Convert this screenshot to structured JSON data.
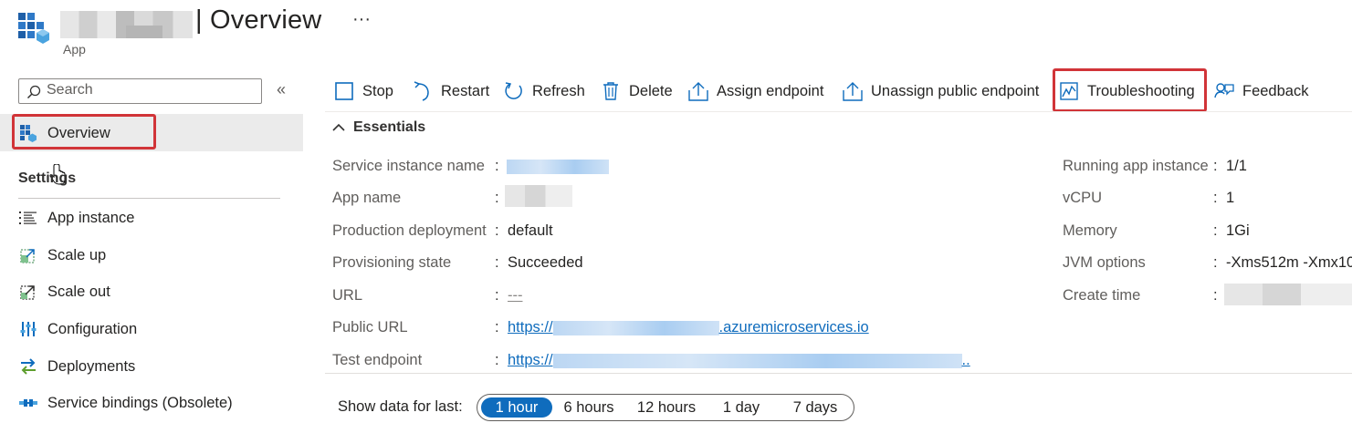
{
  "header": {
    "title": "| Overview",
    "more_label": "···",
    "resource_type": "App"
  },
  "sidebar": {
    "search_placeholder": "Search",
    "collapse_label": "«",
    "overview_label": "Overview",
    "settings_heading": "Settings",
    "items": [
      {
        "label": "App instance",
        "icon": "list-icon"
      },
      {
        "label": "Scale up",
        "icon": "scale-up-icon"
      },
      {
        "label": "Scale out",
        "icon": "scale-out-icon"
      },
      {
        "label": "Configuration",
        "icon": "configuration-icon"
      },
      {
        "label": "Deployments",
        "icon": "deployments-icon"
      },
      {
        "label": "Service bindings (Obsolete)",
        "icon": "service-bindings-icon"
      }
    ]
  },
  "toolbar": {
    "stop": "Stop",
    "restart": "Restart",
    "refresh": "Refresh",
    "delete": "Delete",
    "assign_endpoint": "Assign endpoint",
    "unassign_public_endpoint": "Unassign public endpoint",
    "troubleshooting": "Troubleshooting",
    "feedback": "Feedback"
  },
  "essentials": {
    "heading": "Essentials",
    "left": [
      {
        "key": "Service instance name",
        "value": ""
      },
      {
        "key": "App name",
        "value": ""
      },
      {
        "key": "Production deployment",
        "value": "default"
      },
      {
        "key": "Provisioning state",
        "value": "Succeeded"
      },
      {
        "key": "URL",
        "value": "---"
      },
      {
        "key": "Public URL",
        "value_prefix": "https://",
        "value_suffix": ".azuremicroservices.io"
      },
      {
        "key": "Test endpoint",
        "value_prefix": "https://",
        "value_suffix": ".."
      }
    ],
    "right": [
      {
        "key": "Running app instance",
        "value": "1/1"
      },
      {
        "key": "vCPU",
        "value": "1"
      },
      {
        "key": "Memory",
        "value": "1Gi"
      },
      {
        "key": "JVM options",
        "value": "-Xms512m -Xmx10"
      },
      {
        "key": "Create time",
        "value": ""
      }
    ]
  },
  "time_range": {
    "label": "Show data for last:",
    "options": [
      "1 hour",
      "6 hours",
      "12 hours",
      "1 day",
      "7 days"
    ],
    "selected": "1 hour"
  },
  "colors": {
    "accent": "#0f6cbd",
    "highlight": "#d13438"
  }
}
